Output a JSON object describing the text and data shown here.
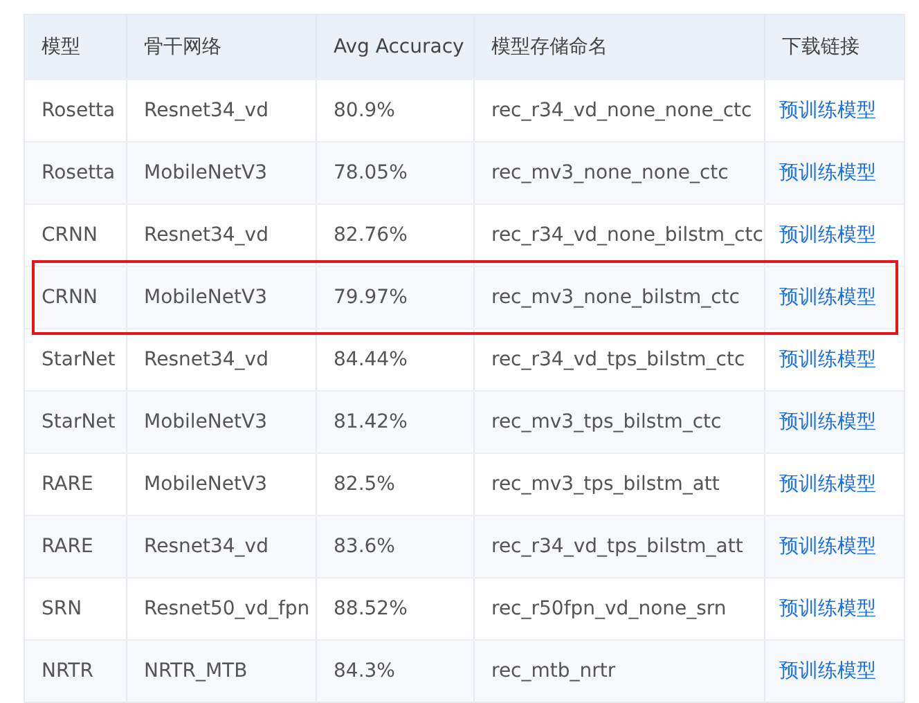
{
  "table": {
    "columns": [
      "模型",
      "骨干网络",
      "Avg Accuracy",
      "模型存储命名",
      "下载链接"
    ],
    "rows": [
      {
        "cells": [
          "Rosetta",
          "Resnet34_vd",
          "80.9%",
          "rec_r34_vd_none_none_ctc"
        ],
        "link": "预训练模型",
        "highlighted": false
      },
      {
        "cells": [
          "Rosetta",
          "MobileNetV3",
          "78.05%",
          "rec_mv3_none_none_ctc"
        ],
        "link": "预训练模型",
        "highlighted": false
      },
      {
        "cells": [
          "CRNN",
          "Resnet34_vd",
          "82.76%",
          "rec_r34_vd_none_bilstm_ctc"
        ],
        "link": "预训练模型",
        "highlighted": false
      },
      {
        "cells": [
          "CRNN",
          "MobileNetV3",
          "79.97%",
          "rec_mv3_none_bilstm_ctc"
        ],
        "link": "预训练模型",
        "highlighted": true
      },
      {
        "cells": [
          "StarNet",
          "Resnet34_vd",
          "84.44%",
          "rec_r34_vd_tps_bilstm_ctc"
        ],
        "link": "预训练模型",
        "highlighted": false
      },
      {
        "cells": [
          "StarNet",
          "MobileNetV3",
          "81.42%",
          "rec_mv3_tps_bilstm_ctc"
        ],
        "link": "预训练模型",
        "highlighted": false
      },
      {
        "cells": [
          "RARE",
          "MobileNetV3",
          "82.5%",
          "rec_mv3_tps_bilstm_att"
        ],
        "link": "预训练模型",
        "highlighted": false
      },
      {
        "cells": [
          "RARE",
          "Resnet34_vd",
          "83.6%",
          "rec_r34_vd_tps_bilstm_att"
        ],
        "link": "预训练模型",
        "highlighted": false
      },
      {
        "cells": [
          "SRN",
          "Resnet50_vd_fpn",
          "88.52%",
          "rec_r50fpn_vd_none_srn"
        ],
        "link": "预训练模型",
        "highlighted": false
      },
      {
        "cells": [
          "NRTR",
          "NRTR_MTB",
          "84.3%",
          "rec_mtb_nrtr"
        ],
        "link": "预训练模型",
        "highlighted": false
      }
    ]
  }
}
